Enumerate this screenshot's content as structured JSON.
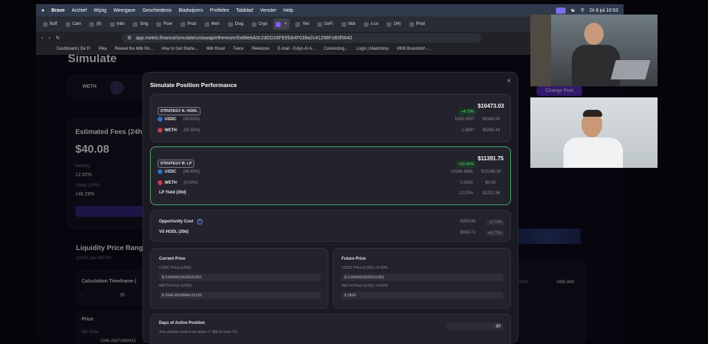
{
  "menubar": {
    "app": "Brave",
    "items": [
      "Archief",
      "Wijzig",
      "Weergave",
      "Geschiedenis",
      "Bladwijzers",
      "Profielen",
      "Tabblad",
      "Venster",
      "Help"
    ],
    "clock": "Di 8 jul  10:53"
  },
  "tabs": [
    "Buff",
    "Cam",
    "(9)",
    "Inbo",
    "Sing",
    "Flow",
    "Prod",
    "Metr",
    "Diag",
    "Cryp",
    "",
    "Yiel",
    "DeFi",
    "Wat",
    "x.co",
    "(34)",
    "Prod"
  ],
  "url": "app.metrix.finance/simulate/uniswap/ethereum/0x88e6A0c2dDD26FEEb64F039a2c41296FcB3f5640",
  "bookmarks": [
    "Dashboard | De Fi",
    "Pika",
    "Reveal the Milk Ro...",
    "How to Get Starte...",
    "Milk Road",
    "Twice",
    "Reelezee",
    "E-mail - Evlyn AI A...",
    "Connecting...",
    "Login | Mailchimp",
    "MKB Brandstof -..."
  ],
  "bg": {
    "title": "Simulate",
    "pair": "WETH",
    "fees_title": "Estimated Fees (24h)",
    "fees_value": "$40.08",
    "monthly_label": "Monthly",
    "monthly_value": "12.02%",
    "yearly_label": "Yearly (APR)",
    "yearly_value": "146.29%",
    "range_title": "Liquidity Price Range",
    "range_sub": "(USDC per WETH)",
    "calc_label": "Calculation Timeframe (",
    "calc_dash": "-",
    "calc_value": "30",
    "price_label": "Price",
    "min_price_label": "Min Price",
    "min_price_value": "2346.26371688415",
    "max_label": "MAX",
    "max_value": "2885.999",
    "change_pool": "Change Pool"
  },
  "modal": {
    "title": "Simulate Position Performance",
    "close": "×",
    "strategy_a": {
      "label": "STRATEGY A: HODL",
      "delta": "+4.73%",
      "total": "$10473.03",
      "rows": [
        {
          "token": "USDC",
          "pct": "(49.50%)",
          "amount": "5180.0957",
          "value": "$5184.59"
        },
        {
          "token": "WETH",
          "pct": "(50.50%)",
          "amount": "1.8887",
          "value": "$5288.44"
        }
      ]
    },
    "strategy_b": {
      "label": "STRATEGY B: LP",
      "delta": "+13.92%",
      "total": "$11391.75",
      "rows": [
        {
          "token": "USDC",
          "pct": "(89.45%)",
          "amount": "10180.3865",
          "value": "$10189.39"
        },
        {
          "token": "WETH",
          "pct": "(0.00%)",
          "amount": "0.0000",
          "value": "$0.00"
        }
      ],
      "yield_label": "LP Yield (30d)",
      "yield_pct": "12.02%",
      "yield_value": "$1202.36"
    },
    "opportunity": {
      "label": "Opportunity Cost",
      "cost_value": "-$283.94",
      "cost_pct": "-2.71%",
      "vs_label": "VS HODL (30d)",
      "vs_value": "$918.72",
      "vs_pct": "+8.77%"
    },
    "current": {
      "title": "Current Price",
      "usdc_label": "USDC Price (USD)",
      "usdc_value": "$  0.9999019526221951",
      "weth_label": "WETH Price (USD)",
      "weth_value": "$  2549.9559884131193"
    },
    "future": {
      "title": "Future Price",
      "usdc_label": "USDC Price (USD) +0.00%",
      "usdc_value": "$  0.9999019526221951",
      "weth_label": "WETH Price (USD) +9.82%",
      "weth_value": "$  2800"
    },
    "days": {
      "title": "Days of Active Position",
      "sub": "Your position need to be active >7 (8d) to cover OC",
      "value": "30"
    }
  },
  "colors": {
    "accent": "#7b3fe4",
    "green": "#4caf6e",
    "modal": "#1b1a23"
  }
}
